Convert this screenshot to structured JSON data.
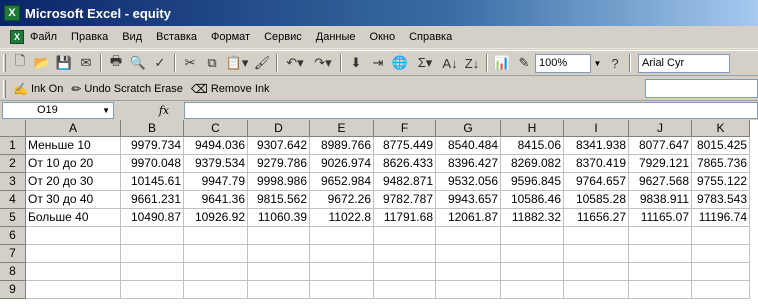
{
  "window": {
    "title": "Microsoft Excel - equity"
  },
  "menu": [
    "Файл",
    "Правка",
    "Вид",
    "Вставка",
    "Формат",
    "Сервис",
    "Данные",
    "Окно",
    "Справка"
  ],
  "toolbar": {
    "zoom": "100%",
    "font": "Arial Cyr"
  },
  "ink": {
    "ink_on": "Ink On",
    "undo_scratch": "Undo Scratch Erase",
    "remove_ink": "Remove Ink"
  },
  "formula_bar": {
    "name_box": "O19",
    "fx": "fx",
    "value": ""
  },
  "sheet": {
    "columns": [
      "A",
      "B",
      "C",
      "D",
      "E",
      "F",
      "G",
      "H",
      "I",
      "J",
      "K"
    ],
    "row_numbers": [
      "1",
      "2",
      "3",
      "4",
      "5",
      "6",
      "7",
      "8",
      "9"
    ],
    "rows": [
      [
        "Меньше 10",
        "9979.734",
        "9494.036",
        "9307.642",
        "8989.766",
        "8775.449",
        "8540.484",
        "8415.06",
        "8341.938",
        "8077.647",
        "8015.425"
      ],
      [
        "От 10 до 20",
        "9970.048",
        "9379.534",
        "9279.786",
        "9026.974",
        "8626.433",
        "8396.427",
        "8269.082",
        "8370.419",
        "7929.121",
        "7865.736"
      ],
      [
        "От 20 до 30",
        "10145.61",
        "9947.79",
        "9998.986",
        "9652.984",
        "9482.871",
        "9532.056",
        "9596.845",
        "9764.657",
        "9627.568",
        "9755.122"
      ],
      [
        "От 30 до 40",
        "9661.231",
        "9641.36",
        "9815.562",
        "9672.26",
        "9782.787",
        "9943.657",
        "10586.46",
        "10585.28",
        "9838.911",
        "9783.543"
      ],
      [
        "Больше 40",
        "10490.87",
        "10926.92",
        "11060.39",
        "11022.8",
        "11791.68",
        "12061.87",
        "11882.32",
        "11656.27",
        "11165.07",
        "11196.74"
      ],
      [
        "",
        "",
        "",
        "",
        "",
        "",
        "",
        "",
        "",
        "",
        ""
      ],
      [
        "",
        "",
        "",
        "",
        "",
        "",
        "",
        "",
        "",
        "",
        ""
      ],
      [
        "",
        "",
        "",
        "",
        "",
        "",
        "",
        "",
        "",
        "",
        ""
      ],
      [
        "",
        "",
        "",
        "",
        "",
        "",
        "",
        "",
        "",
        "",
        ""
      ]
    ]
  }
}
